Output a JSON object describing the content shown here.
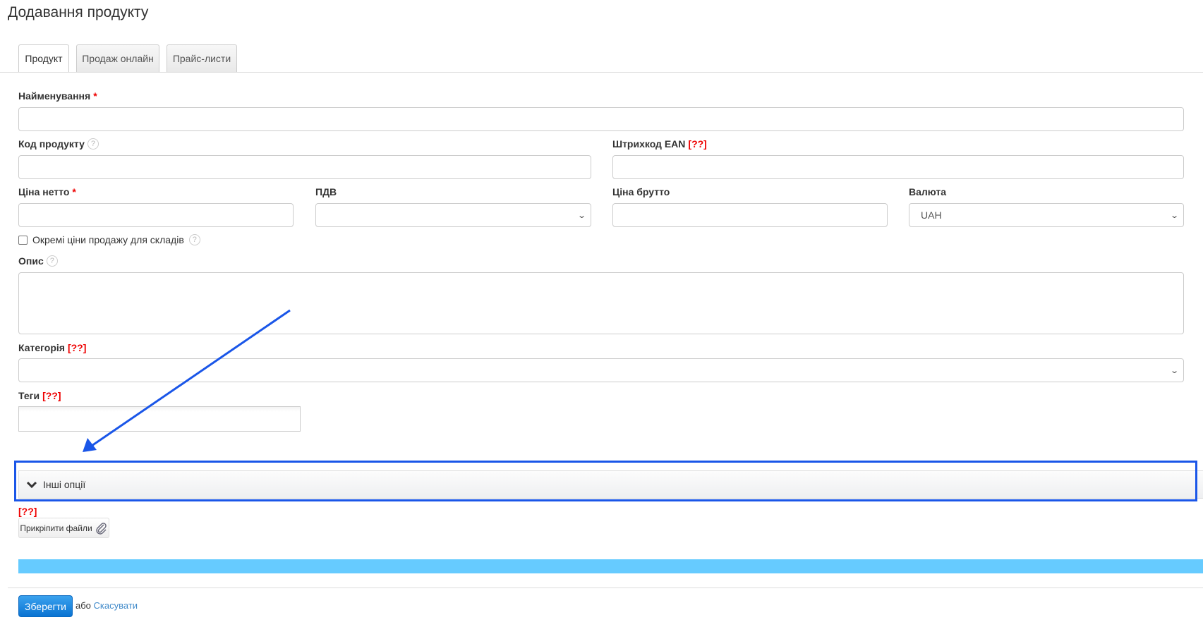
{
  "page_title": "Додавання продукту",
  "tabs": [
    {
      "label": "Продукт",
      "active": true
    },
    {
      "label": "Продаж онлайн",
      "active": false
    },
    {
      "label": "Прайс-листи",
      "active": false
    }
  ],
  "form": {
    "name": {
      "label": "Найменування",
      "required": "*",
      "value": ""
    },
    "code": {
      "label": "Код продукту",
      "help": "?",
      "value": ""
    },
    "ean": {
      "label": "Штрихкод EAN",
      "warn": "[??]",
      "value": ""
    },
    "net_price": {
      "label": "Ціна нетто",
      "required": "*",
      "value": ""
    },
    "vat": {
      "label": "ПДВ",
      "value": ""
    },
    "gross_price": {
      "label": "Ціна брутто",
      "value": ""
    },
    "currency": {
      "label": "Валюта",
      "value": "UAH"
    },
    "separate_prices": {
      "label": "Окремі ціни продажу для складів",
      "help": "?",
      "checked": false
    },
    "description": {
      "label": "Опис",
      "help": "?",
      "value": ""
    },
    "category": {
      "label": "Категорія",
      "warn": "[??]",
      "value": ""
    },
    "tags": {
      "label": "Теги",
      "warn": "[??]",
      "value": ""
    }
  },
  "other_options": {
    "label": "Інші опції"
  },
  "attachments": {
    "warn": "[??]",
    "button_label": "Прикріпити файли"
  },
  "footer": {
    "save_label": "Зберегти",
    "or_text": "або",
    "cancel_label": "Скасувати"
  },
  "colors": {
    "annotation": "#1a56e8",
    "progress_bar": "#66cbff",
    "primary": "#0a73d2"
  }
}
